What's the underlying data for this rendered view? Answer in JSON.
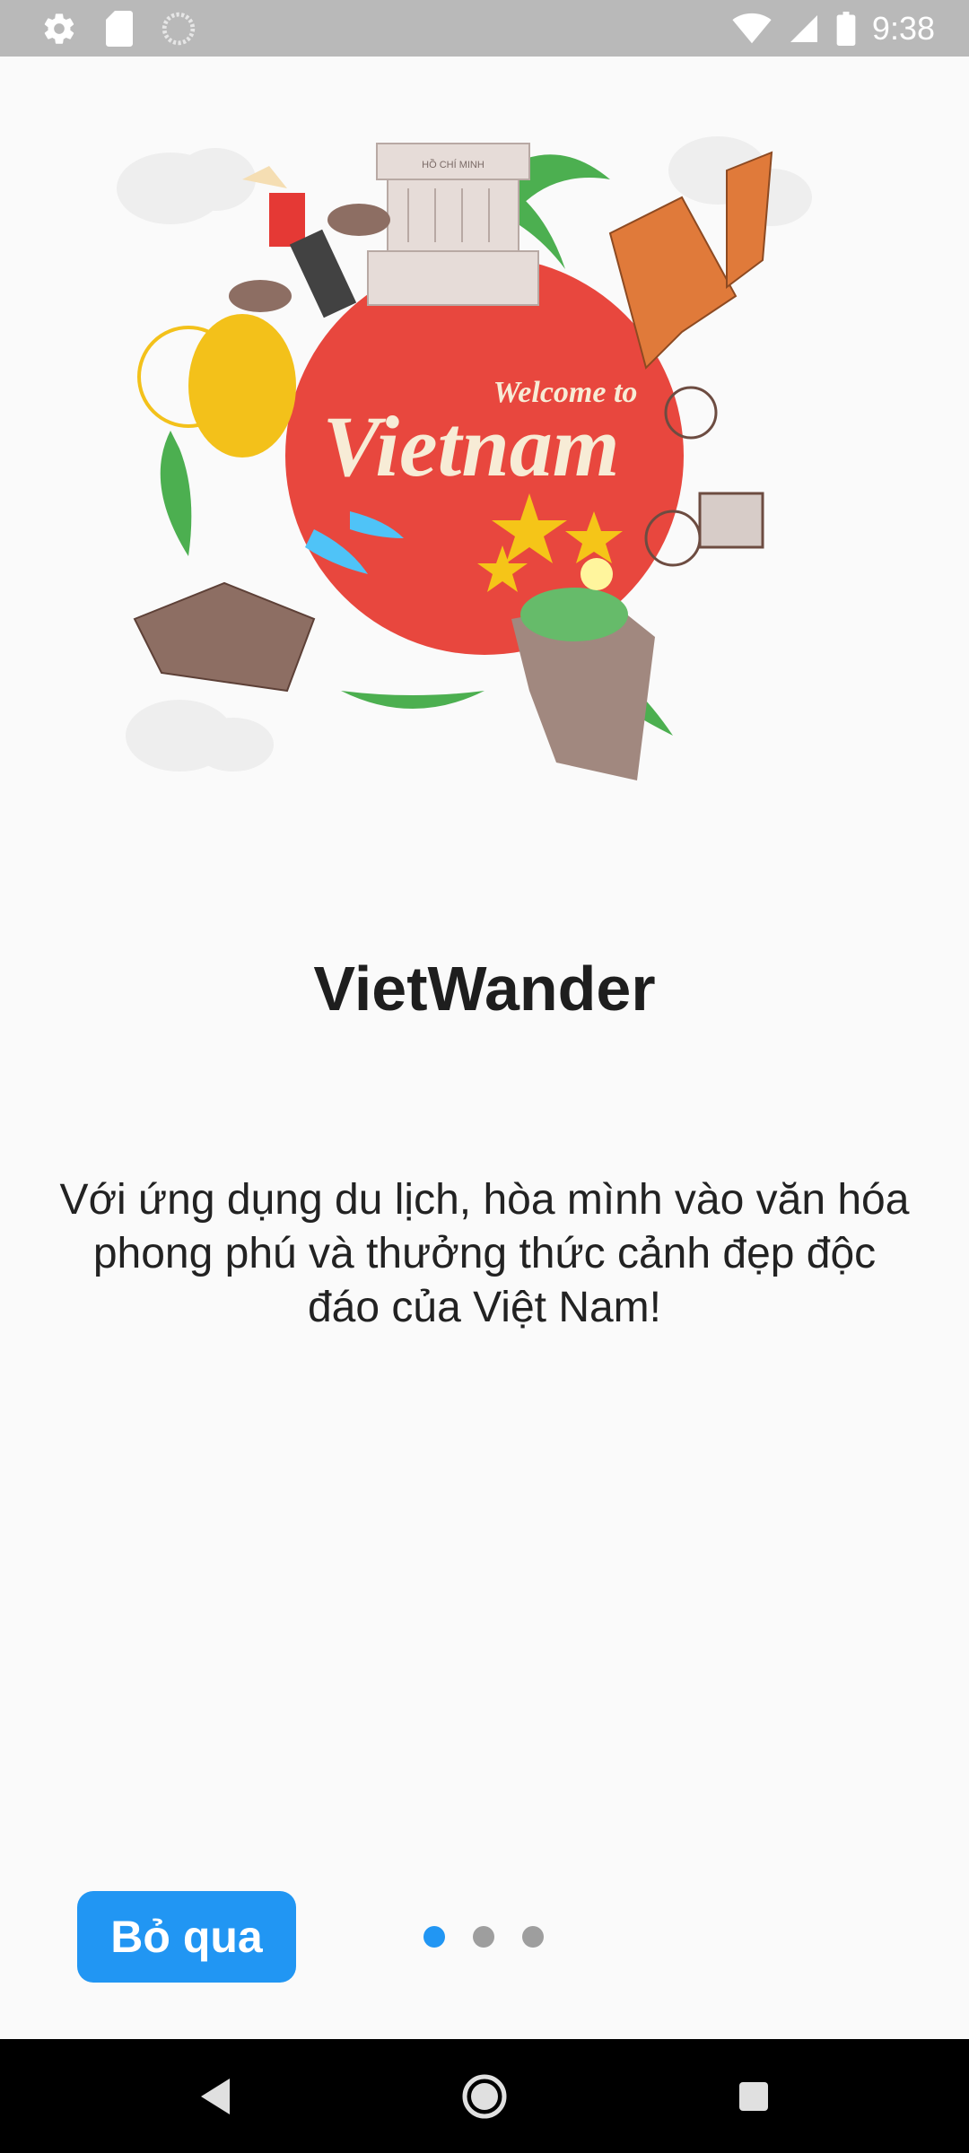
{
  "status_bar": {
    "time": "9:38",
    "left_icons": [
      "settings-icon",
      "sd-card-icon",
      "loading-icon"
    ],
    "right_icons": [
      "wifi-icon",
      "signal-icon",
      "battery-icon"
    ]
  },
  "illustration": {
    "welcome_text": "Welcome to",
    "country_text": "Vietnam",
    "globe_color": "#e8473e",
    "star_color": "#f5c518",
    "landmark_text": "HỒ CHÍ MINH"
  },
  "onboarding": {
    "title": "VietWander",
    "description": "Với ứng dụng du lịch, hòa mình vào văn hóa phong phú và thưởng thức cảnh đẹp độc đáo của Việt Nam!",
    "skip_label": "Bỏ qua",
    "page_count": 3,
    "active_page": 1
  },
  "nav_bar": {
    "buttons": [
      "back-icon",
      "home-icon",
      "recents-icon"
    ]
  },
  "colors": {
    "accent": "#2196f3",
    "background": "#fafafa",
    "status_bar": "#b9b9b9"
  }
}
